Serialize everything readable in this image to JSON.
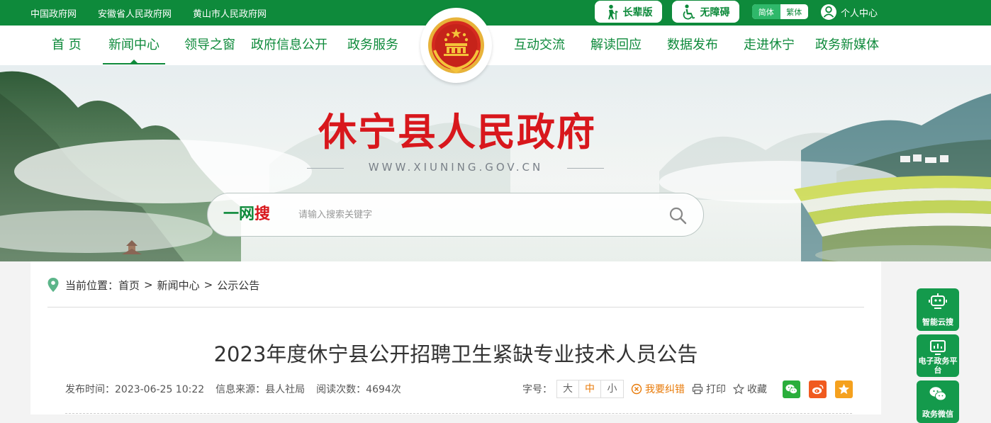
{
  "colors": {
    "brand_green": "#0e8a3b",
    "title_red": "#d8171c",
    "accent_orange": "#e87a08"
  },
  "top_links": [
    "中国政府网",
    "安徽省人民政府网",
    "黄山市人民政府网"
  ],
  "top_right": {
    "elderly_label": "长辈版",
    "accessible_label": "无障碍",
    "lang_simplified": "简体",
    "lang_traditional": "繁体",
    "user_center": "个人中心"
  },
  "nav": {
    "items": [
      "首 页",
      "新闻中心",
      "领导之窗",
      "政府信息公开",
      "政务服务",
      "互动交流",
      "解读回应",
      "数据发布",
      "走进休宁",
      "政务新媒体"
    ],
    "active": "新闻中心"
  },
  "banner": {
    "site_title": "休宁县人民政府",
    "domain": "WWW.XIUNING.GOV.CN"
  },
  "search": {
    "brand_part1": "一网",
    "brand_part2": "搜",
    "placeholder": "请输入搜索关键字",
    "icon": "search-icon"
  },
  "breadcrumb": {
    "prefix": "当前位置：",
    "items": [
      "首页",
      "新闻中心",
      "公示公告"
    ],
    "separator": ">"
  },
  "article": {
    "title": "2023年度休宁县公开招聘卫生紧缺专业技术人员公告",
    "publish_time": "发布时间：2023-06-25 10:22",
    "source": "信息来源：县人社局",
    "views": "阅读次数：4694次",
    "font_size_label": "字号：",
    "font_sizes": [
      "大",
      "中",
      "小"
    ],
    "font_size_selected": "中",
    "report_error": "我要纠错",
    "print": "打印",
    "favorite": "收藏"
  },
  "share": {
    "wechat_color": "#2aae3b",
    "weibo_color": "#f05a1f",
    "qzone_color": "#f5a11e"
  },
  "float_panel": [
    {
      "label": "智能云搜",
      "icon": "robot-icon"
    },
    {
      "label": "电子政务平台",
      "icon": "chart-screen-icon"
    },
    {
      "label": "政务微信",
      "icon": "wechat-icon"
    }
  ]
}
